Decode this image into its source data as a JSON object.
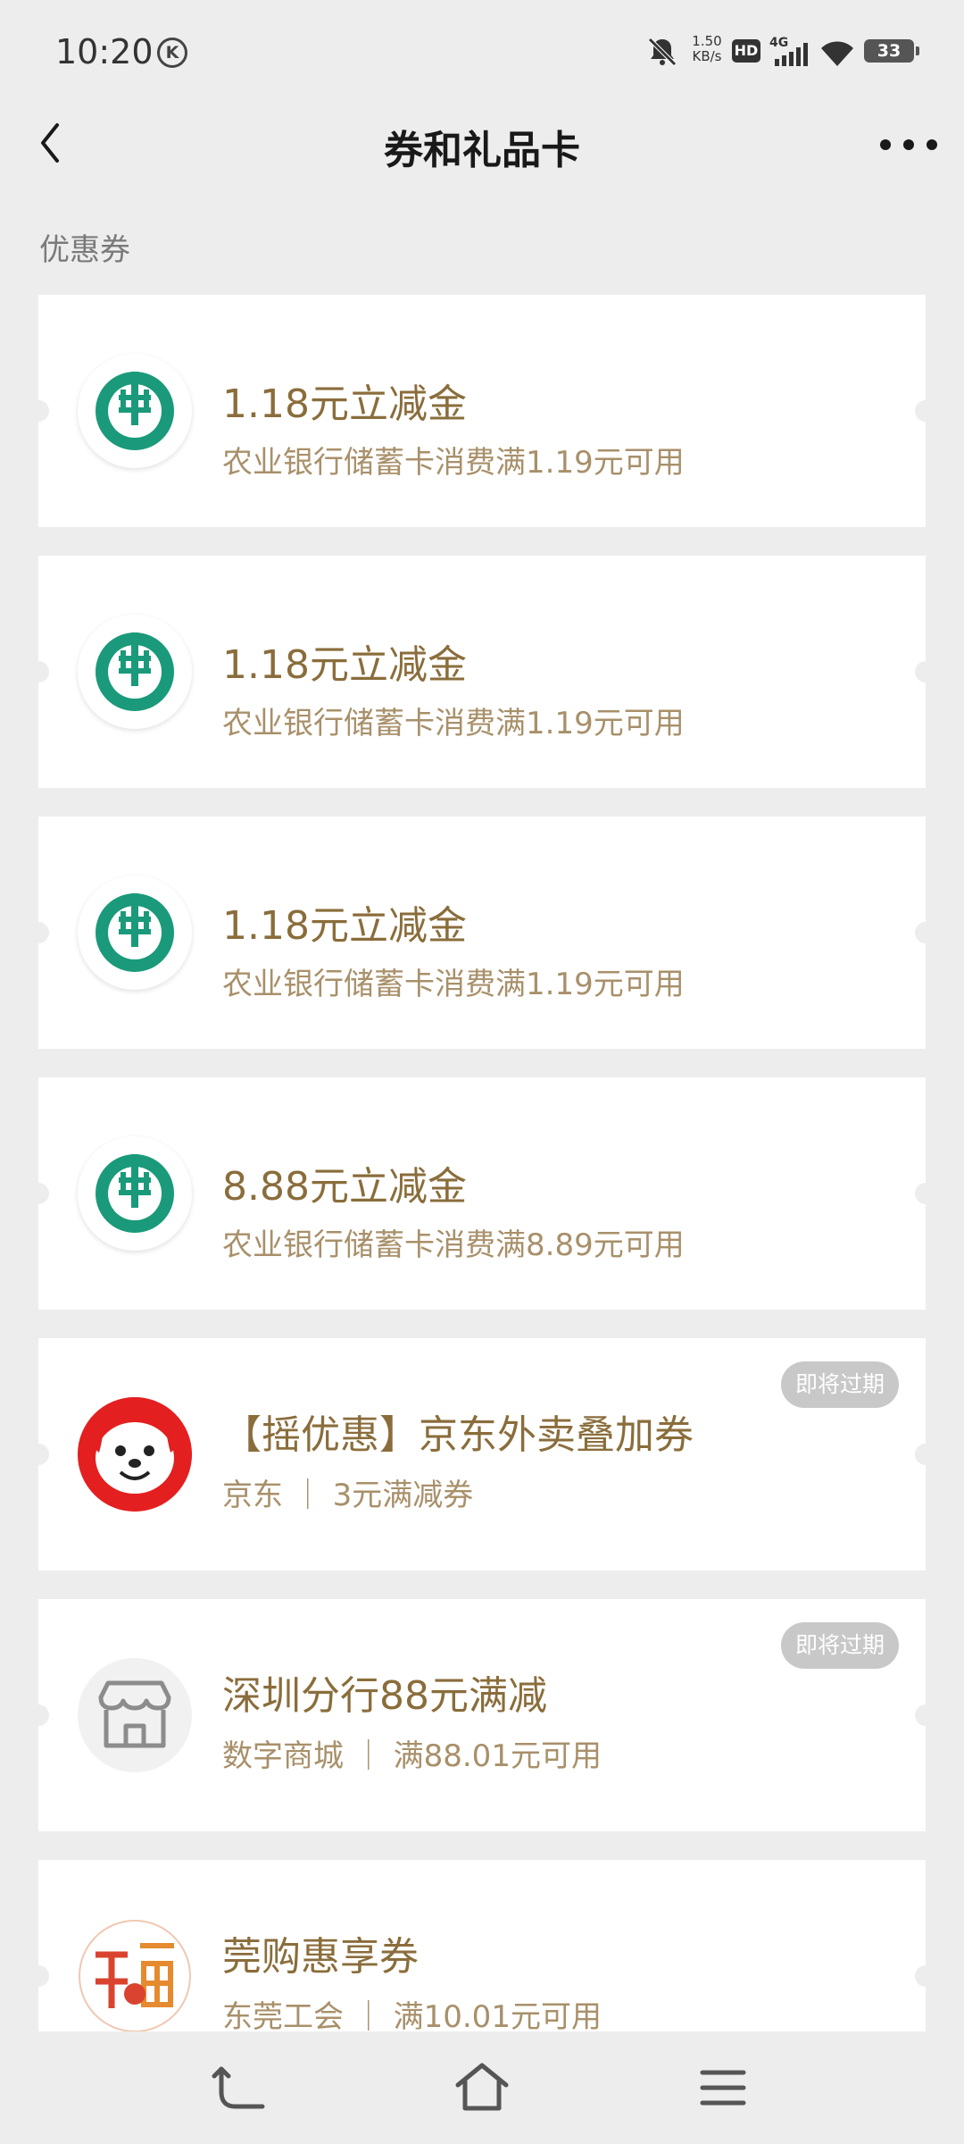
{
  "status_bar": {
    "time": "10:20",
    "k_label": "K",
    "net_speed_value": "1.50",
    "net_speed_unit": "KB/s",
    "hd_label": "HD",
    "network_type": "4G",
    "battery": "33"
  },
  "header": {
    "title": "券和礼品卡"
  },
  "section_label": "优惠券",
  "coupons": [
    {
      "title": "1.18元立减金",
      "subtitle": "农业银行储蓄卡消费满1.19元可用",
      "logo": "abc-bank-logo"
    },
    {
      "title": "1.18元立减金",
      "subtitle": "农业银行储蓄卡消费满1.19元可用",
      "logo": "abc-bank-logo"
    },
    {
      "title": "1.18元立减金",
      "subtitle": "农业银行储蓄卡消费满1.19元可用",
      "logo": "abc-bank-logo"
    },
    {
      "title": "8.88元立减金",
      "subtitle": "农业银行储蓄卡消费满8.89元可用",
      "logo": "abc-bank-logo"
    },
    {
      "title": "【摇优惠】京东外卖叠加券",
      "subtitle": "京东 ｜ 3元满减券",
      "logo": "jd-dog-logo",
      "badge": "即将过期"
    },
    {
      "title": "深圳分行88元满减",
      "subtitle": "数字商城 ｜ 满88.01元可用",
      "logo": "shop-icon",
      "badge": "即将过期"
    },
    {
      "title": "莞购惠享券",
      "subtitle": "东莞工会 ｜ 满10.01元可用",
      "logo": "fu-character-logo"
    }
  ],
  "icons": {
    "back": "chevron-left-icon",
    "more": "more-dots-icon",
    "nav_back": "nav-back-icon",
    "nav_home": "home-icon",
    "nav_menu": "menu-icon"
  },
  "colors": {
    "background": "#ededed",
    "coupon_title": "#8a6d3b",
    "coupon_subtitle": "#a8906a",
    "abc_green": "#1a9a7a",
    "jd_red": "#e41f1f",
    "badge": "#c8c8c8"
  }
}
